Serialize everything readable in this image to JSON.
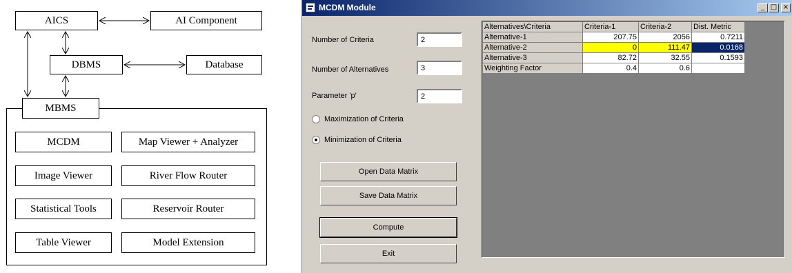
{
  "diagram": {
    "aics": "AICS",
    "ai_component": "AI Component",
    "dbms": "DBMS",
    "database": "Database",
    "mbms": "MBMS",
    "modules": [
      "MCDM",
      "Map Viewer + Analyzer",
      "Image Viewer",
      "River Flow Router",
      "Statistical Tools",
      "Reservoir Router",
      "Table Viewer",
      "Model Extension"
    ]
  },
  "window": {
    "title": "MCDM Module",
    "controls": {
      "minimize": "_",
      "maximize": "□",
      "close": "×"
    }
  },
  "form": {
    "criteria_label": "Number of Criteria",
    "criteria_value": "2",
    "alternatives_label": "Number of Alternatives",
    "alternatives_value": "3",
    "parameter_label": "Parameter 'p'",
    "parameter_value": "2",
    "maximization_label": "Maximization of Criteria",
    "minimization_label": "Minimization of Criteria",
    "selected_option": "minimization"
  },
  "buttons": {
    "open": "Open Data Matrix",
    "save": "Save Data Matrix",
    "compute": "Compute",
    "exit": "Exit"
  },
  "table": {
    "headers": [
      "Alternatives\\Criteria",
      "Criteria-1",
      "Criteria-2",
      "Dist. Metric"
    ],
    "rows": [
      [
        "Alternative-1",
        "207.75",
        "2056",
        "0.7211"
      ],
      [
        "Alternative-2",
        "0",
        "111.47",
        "0.0168"
      ],
      [
        "Alternative-3",
        "82.72",
        "32.55",
        "0.1593"
      ],
      [
        "Weighting Factor",
        "0.4",
        "0.6",
        ""
      ]
    ],
    "highlight_color": "#ffff00",
    "selection_color": "#0a246a"
  }
}
